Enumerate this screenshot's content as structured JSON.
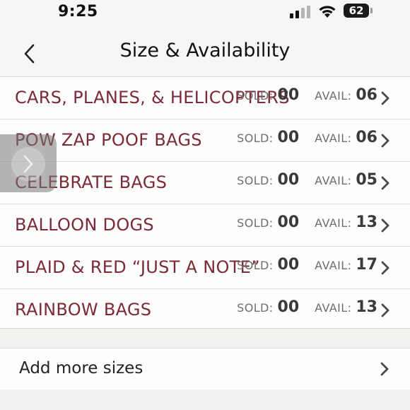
{
  "status_bar": {
    "time": "9:25",
    "battery": "62"
  },
  "nav": {
    "title": "Size & Availability",
    "back_icon": "chevron-left-icon"
  },
  "labels": {
    "sold": "SOLD:",
    "avail": "AVAIL:"
  },
  "items": [
    {
      "name": "CARS, PLANES, & HELICOPTERS",
      "sold": "00",
      "avail": "06"
    },
    {
      "name": "POW ZAP POOF BAGS",
      "sold": "00",
      "avail": "06"
    },
    {
      "name": "CELEBRATE BAGS",
      "sold": "00",
      "avail": "05"
    },
    {
      "name": "BALLOON DOGS",
      "sold": "00",
      "avail": "13"
    },
    {
      "name": "PLAID & RED “JUST A NOTE”",
      "sold": "00",
      "avail": "17"
    },
    {
      "name": "RAINBOW BAGS",
      "sold": "00",
      "avail": "13"
    }
  ],
  "add_more": {
    "label": "Add more sizes"
  },
  "colors": {
    "item_text": "#7b2a36",
    "background": "#f7f6f5"
  }
}
